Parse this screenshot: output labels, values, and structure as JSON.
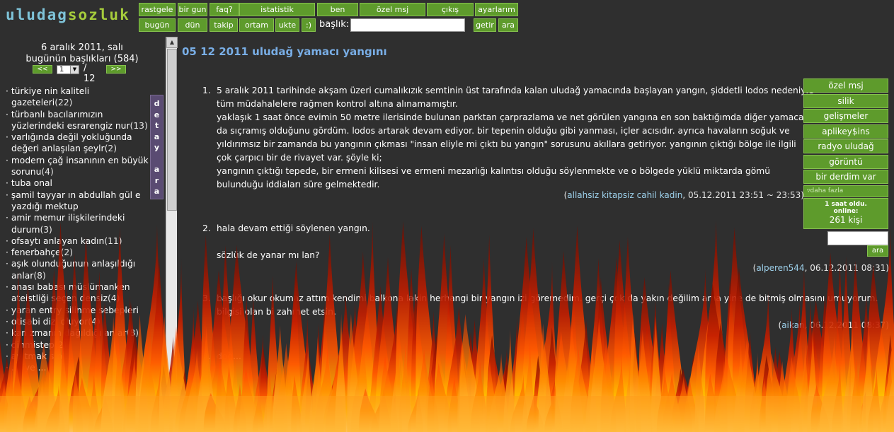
{
  "logo": {
    "part1": "uludag",
    "part2": "sozluk"
  },
  "nav": {
    "row1": [
      "rastgele",
      "bir gun",
      "faq?",
      "istatistik",
      "ben",
      "özel msj",
      "çıkış",
      "ayarlarım"
    ],
    "row2": [
      "bugün",
      "dün",
      "takip",
      "ortam",
      "ukte",
      ":)"
    ],
    "search_label": "başlık:",
    "search_value": "",
    "getir": "getir",
    "ara": "ara"
  },
  "sidebar": {
    "date": "6 aralık 2011, salı",
    "today": "bugünün başlıkları (584)",
    "pager": {
      "prev": "<<",
      "next": ">>",
      "page": "1",
      "sep": "/ 12"
    },
    "detay_tab": [
      "d",
      "e",
      "t",
      "a",
      "y",
      "",
      "a",
      "r",
      "a"
    ],
    "topics": [
      {
        "title": "türkiye nin kaliteli gazeteleri",
        "count": "(22)"
      },
      {
        "title": "türbanlı bacılarımızın yüzlerindeki esrarengiz nur",
        "count": "(13)"
      },
      {
        "title": "varlığında değil yokluğunda değeri anlaşılan şeylr",
        "count": "(2)"
      },
      {
        "title": "modern çağ insanının en büyük sorunu",
        "count": "(4)"
      },
      {
        "title": "tuba onal",
        "count": ""
      },
      {
        "title": "şamil tayyar ın abdullah gül e yazdığı mektup",
        "count": ""
      },
      {
        "title": "amir memur ilişkilerindeki durum",
        "count": "(3)"
      },
      {
        "title": "ofsaytı anlayan kadın",
        "count": "(11)"
      },
      {
        "title": "fenerbahçe",
        "count": "(2)"
      },
      {
        "title": "aşık olunduğunun anlaşıldığı anlar",
        "count": "(8)"
      },
      {
        "title": "anası babası müslümanken ateistliği seçen densiz",
        "count": "(4)"
      },
      {
        "title": "yaran entry silinme sebepleri",
        "count": ""
      },
      {
        "title": "otisabi dizi oluyor",
        "count": "(4)"
      },
      {
        "title": "kan zmanın dağıldığı anlar",
        "count": "(8)"
      },
      {
        "title": "dinmistep",
        "count": "(2)"
      },
      {
        "title": "ay tmak s n ...",
        "count": ""
      },
      {
        "title": "... iye ...",
        "count": ""
      }
    ]
  },
  "topic": {
    "title": "05 12 2011 uludağ yamacı yangını"
  },
  "entries": [
    {
      "num": "1.",
      "lines": [
        "5 aralık 2011 tarihinde akşam üzeri cumalıkızık semtinin üst tarafında kalan uludağ yamacında başlayan yangın, şiddetli lodos nedeniyle",
        "tüm müdahalelere rağmen kontrol altına alınamamıştır.",
        "yaklaşık 1 saat önce evimin 50 metre ilerisinde bulunan parktan çarprazlama ve net görülen yangına en son baktığımda diğer yamaca",
        "da sıçramış olduğunu gördüm. lodos artarak devam ediyor. bir tepenin olduğu gibi yanması, içler acısıdır. ayrıca havaların soğuk ve",
        "yıldırımsız bir zamanda bu yangının çıkması \"insan eliyle mi çıktı bu yangın\" sorusunu akıllara getiriyor. yangının çıktığı bölge ile ilgili",
        "çok çarpıcı bir de rivayet var. şöyle ki;",
        "yangının çıktığı tepede, bir ermeni kilisesi ve ermeni mezarlığı kalıntısı olduğu söylenmekte ve o bölgede yüklü miktarda gömü",
        "bulunduğu iddiaları süre gelmektedir."
      ],
      "author": "allahsiz kitapsiz cahil kadin",
      "date": ", 05.12.2011 23:51 ~ 23:53)"
    },
    {
      "num": "2.",
      "lines": [
        "hala devam ettiği söylenen yangın.",
        "",
        "sözlük de yanar mı lan?"
      ],
      "author": "alperen544",
      "date": ", 06.12.2011 08:31)"
    },
    {
      "num": "3.",
      "lines": [
        "başlığı okur okumaz attım kendimi balkona lakin herhangi bir yangın izi göremedim. gerçi çok da yakın değilim ama yine de bitmiş olmasını umuyorum.",
        "bilgisi olan bi zahmet etsin."
      ],
      "author": "aikan",
      "date": ", 06.12.2011 08:37)"
    },
    {
      "num": "4.",
      "lines": [
        "doğ..."
      ],
      "author": "",
      "date": ""
    }
  ],
  "right_menu": {
    "items": [
      "özel msj",
      "silik",
      "gelişmeler",
      "aplikey$ins",
      "radyo uludağ",
      "görüntü",
      "bir derdim var"
    ],
    "more": "▿daha fazla",
    "online_line1": "1 saat oldu.",
    "online_line2": "online:",
    "online_count": "261 kişi",
    "search_btn": "ara"
  },
  "colors": {
    "bg": "#2f2f2f",
    "button": "#5e9b2c",
    "title": "#79aee6",
    "author": "#9dd0ea",
    "detay": "#5a4b72"
  }
}
